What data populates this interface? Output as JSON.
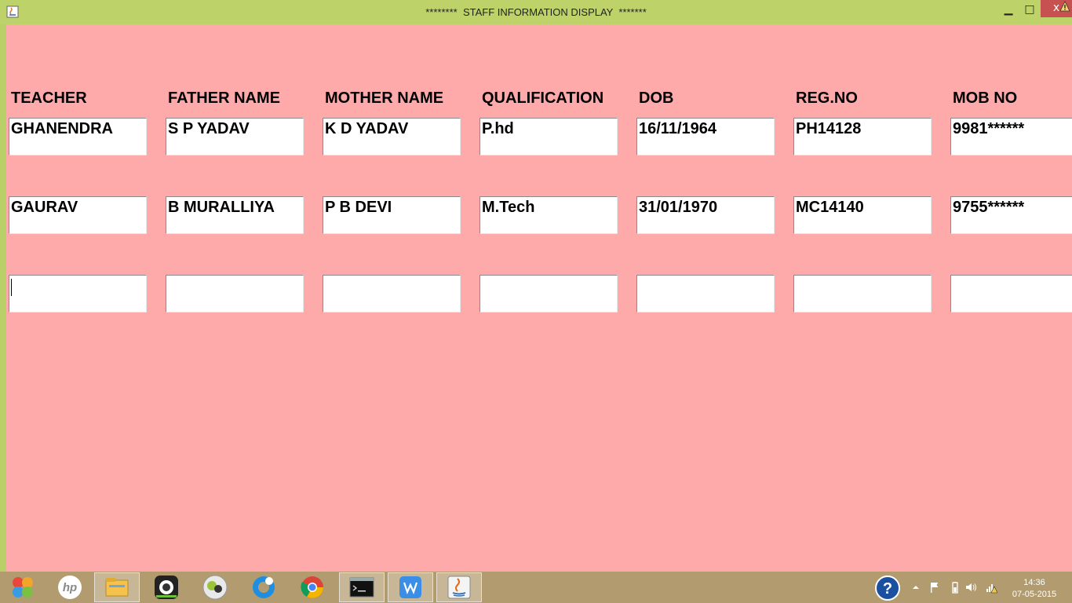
{
  "window": {
    "title": "********  STAFF INFORMATION DISPLAY  *******",
    "minimize_glyph": "▁",
    "maximize_glyph": "□",
    "close_glyph": "x"
  },
  "table": {
    "headers": [
      "TEACHER",
      "FATHER NAME",
      "MOTHER NAME",
      "QUALIFICATION",
      "DOB",
      "REG.NO",
      "MOB NO"
    ],
    "rows": [
      [
        "GHANENDRA",
        "S P YADAV",
        "K D YADAV",
        "P.hd",
        "16/11/1964",
        "PH14128",
        "9981******"
      ],
      [
        "GAURAV",
        "B MURALLIYA",
        "P B DEVI",
        "M.Tech",
        "31/01/1970",
        "MC14140",
        "9755******"
      ],
      [
        "",
        "",
        "",
        "",
        "",
        "",
        ""
      ]
    ]
  },
  "taskbar": {
    "items": [
      {
        "name": "start-icon"
      },
      {
        "name": "hp-icon"
      },
      {
        "name": "file-explorer-icon"
      },
      {
        "name": "camera-app-icon"
      },
      {
        "name": "media-app-icon"
      },
      {
        "name": "browser-blue-icon"
      },
      {
        "name": "chrome-icon"
      },
      {
        "name": "command-prompt-icon"
      },
      {
        "name": "wps-writer-icon"
      },
      {
        "name": "java-icon"
      }
    ],
    "clock": {
      "time": "14:36",
      "date": "07-05-2015"
    }
  },
  "colors": {
    "titlebar": "#bdd36a",
    "content_bg": "#ffaaaa",
    "close_button": "#c75050",
    "taskbar": "#b29c6f"
  }
}
